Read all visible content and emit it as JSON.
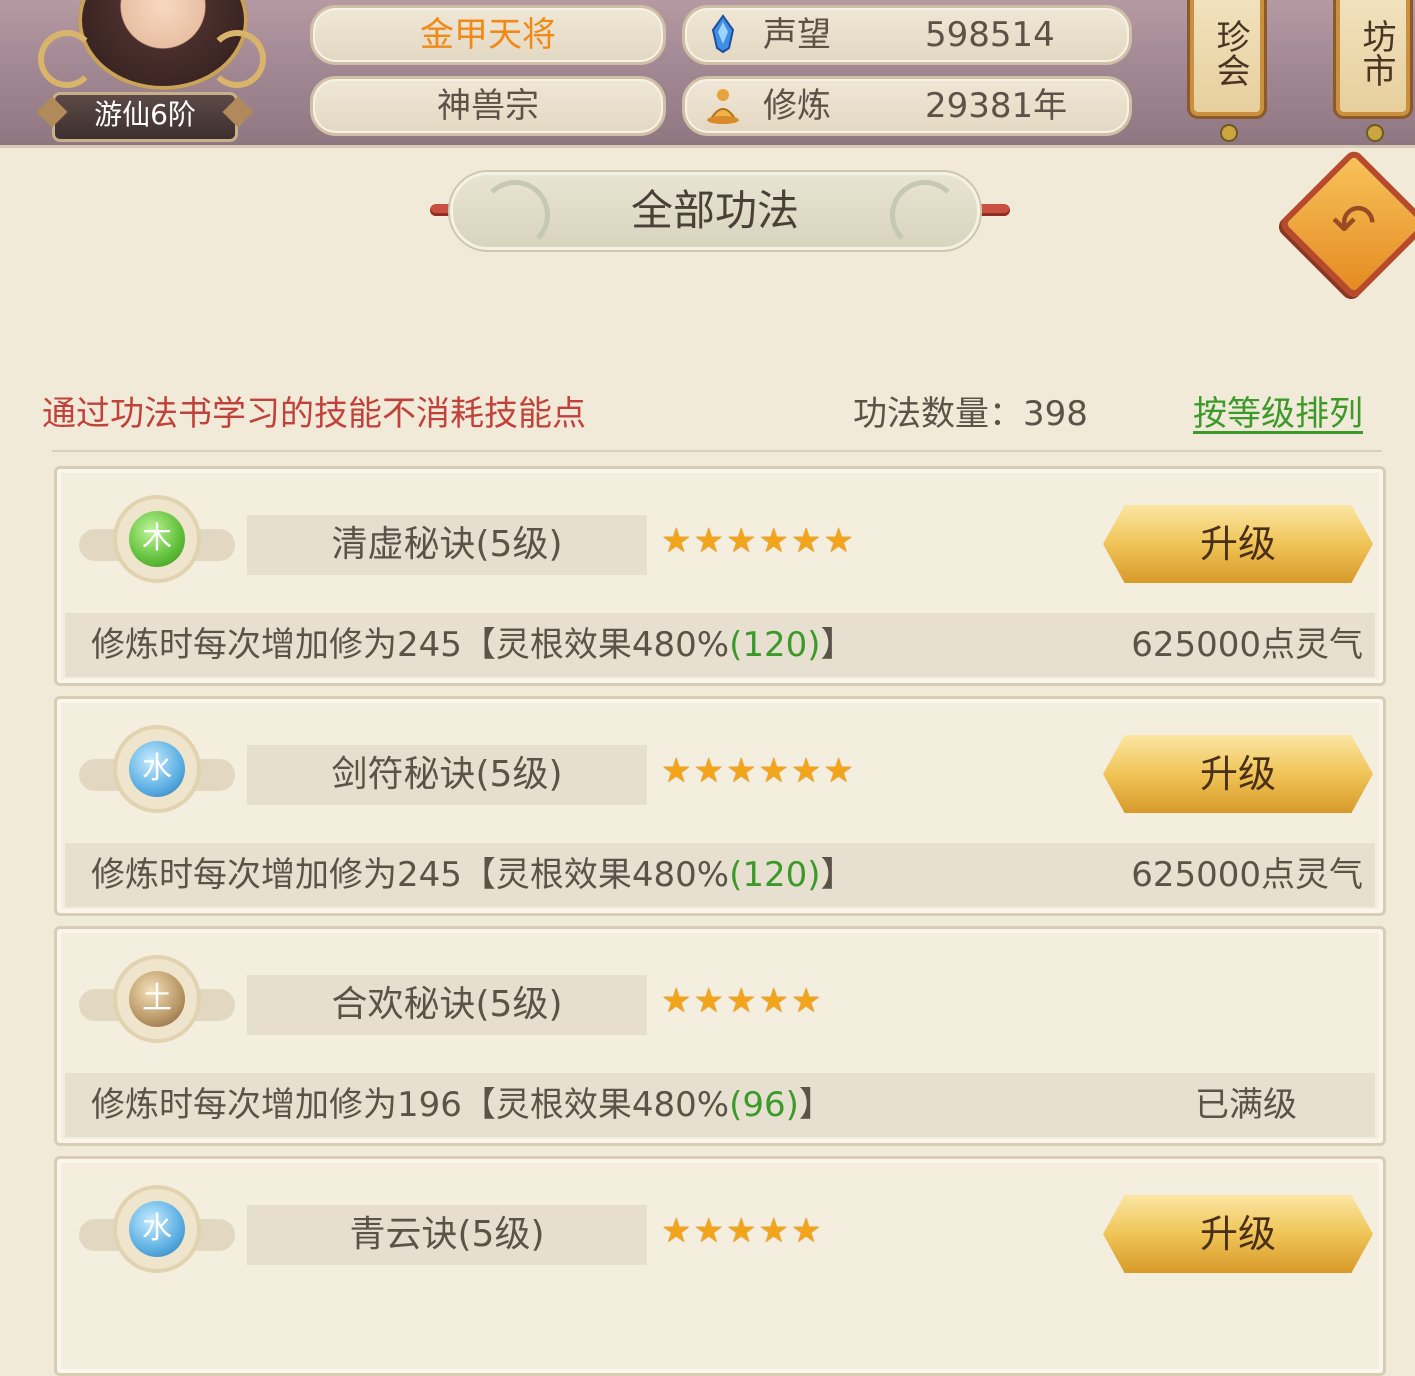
{
  "player": {
    "rank": "游仙6阶",
    "title": "金甲天将",
    "sect": "神兽宗"
  },
  "stats": [
    {
      "icon": "blue-crystal-icon",
      "label": "声望",
      "value": "598514"
    },
    {
      "icon": "meditation-icon",
      "label": "修炼",
      "value": "29381年"
    }
  ],
  "side_buttons": [
    {
      "label": "珍会"
    },
    {
      "label": "坊市"
    }
  ],
  "page_title": "全部功法",
  "notice": "通过功法书学习的技能不消耗技能点",
  "count_text": "功法数量：398",
  "sort_link": "按等级排列",
  "skills": [
    {
      "element": "木",
      "element_icon": "wood-element-icon",
      "name": "清虚秘诀(5级)",
      "stars": "★★★★★★",
      "star_count": 6,
      "desc_main": "修炼时每次增加修为245【灵根效果480%",
      "desc_green": "(120)",
      "desc_end": "】",
      "cost": "625000点灵气",
      "button": "升级"
    },
    {
      "element": "水",
      "element_icon": "water-element-icon",
      "name": "剑符秘诀(5级)",
      "stars": "★★★★★★",
      "star_count": 6,
      "desc_main": "修炼时每次增加修为245【灵根效果480%",
      "desc_green": "(120)",
      "desc_end": "】",
      "cost": "625000点灵气",
      "button": "升级"
    },
    {
      "element": "土",
      "element_icon": "earth-element-icon",
      "name": "合欢秘诀(5级)",
      "stars": "★★★★★",
      "star_count": 5,
      "desc_main": "修炼时每次增加修为196【灵根效果480%",
      "desc_green": "(96)",
      "desc_end": "】",
      "status": "已满级"
    },
    {
      "element": "水",
      "element_icon": "water-element-icon",
      "name": "青云诀(5级)",
      "stars": "★★★★★",
      "star_count": 5,
      "button": "升级"
    }
  ],
  "colors": {
    "accent_orange": "#ef8a17",
    "notice_red": "#c0423a",
    "link_green": "#3c9a2a",
    "star_gold": "#f2a51b"
  }
}
